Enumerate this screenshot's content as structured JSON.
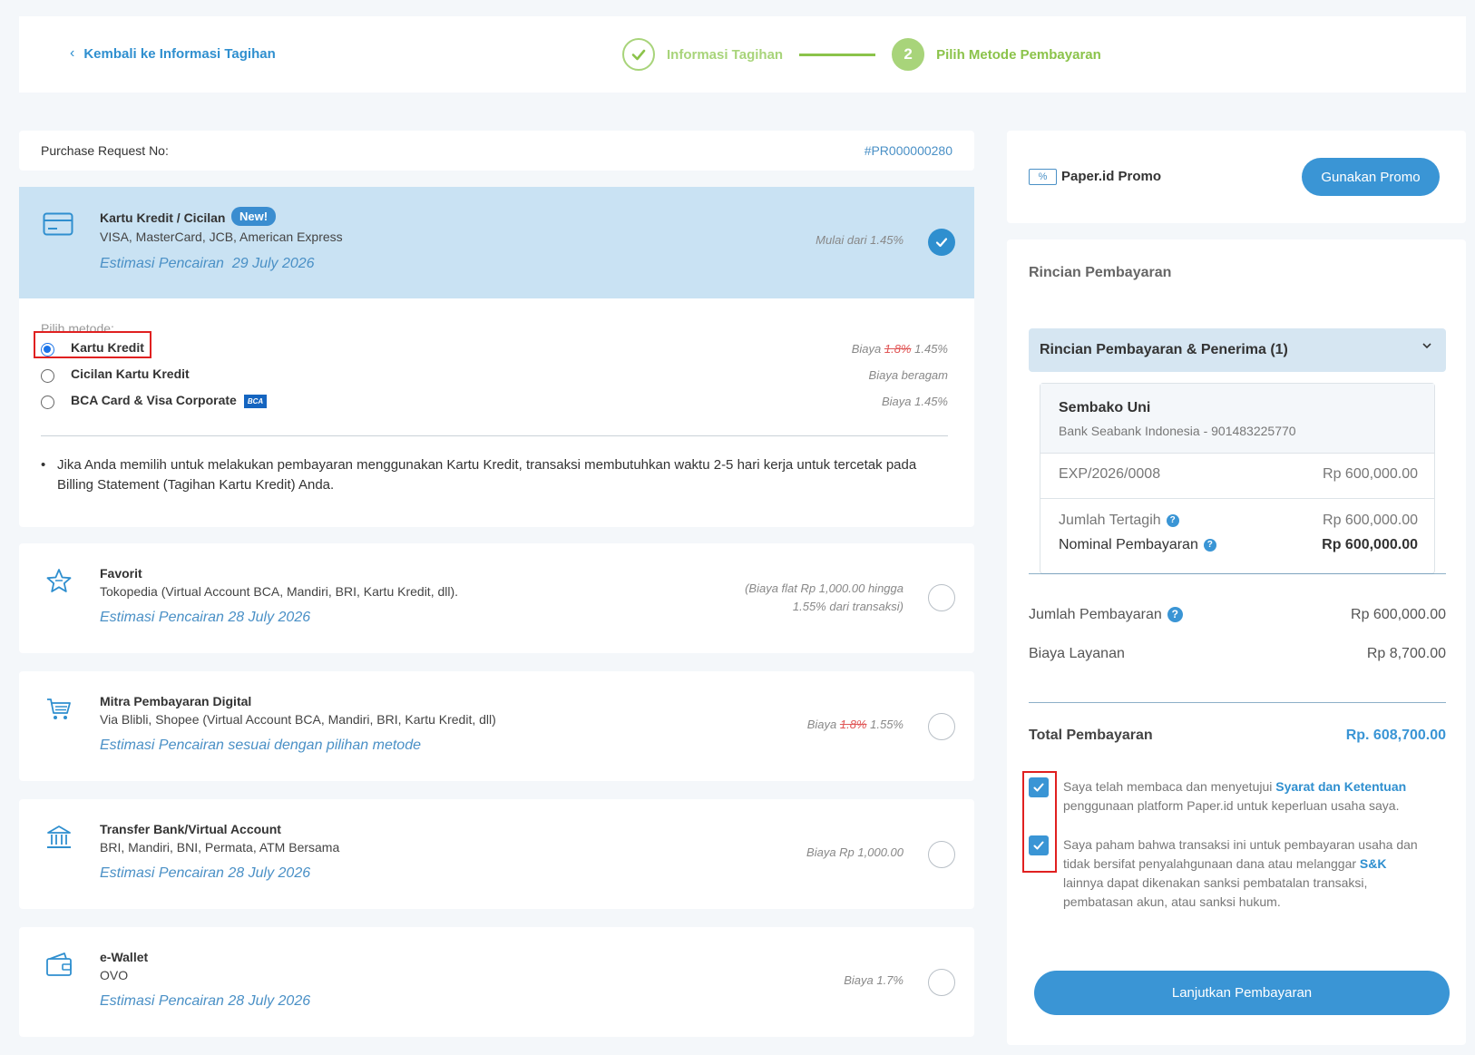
{
  "header": {
    "back_label": "Kembali ke Informasi Tagihan",
    "steps": [
      {
        "number": "✓",
        "label": "Informasi Tagihan"
      },
      {
        "number": "2",
        "label": "Pilih Metode Pembayaran"
      }
    ]
  },
  "purchase_request": {
    "label": "Purchase Request No:",
    "number": "#PR000000280"
  },
  "credit_card": {
    "title": "Kartu Kredit / Cicilan",
    "badge": "New!",
    "subtitle": "VISA, MasterCard, JCB, American Express",
    "estimate_label": "Estimasi Pencairan",
    "estimate_date": "29 July 2026",
    "fee": "Mulai dari 1.45%",
    "choose_label": "Pilih metode:",
    "options": [
      {
        "label": "Kartu Kredit",
        "fee_prefix": "Biaya",
        "fee_old": "1.8%",
        "fee": "1.45%",
        "selected": true
      },
      {
        "label": "Cicilan Kartu Kredit",
        "fee": "Biaya beragam",
        "selected": false
      },
      {
        "label": "BCA Card & Visa Corporate",
        "logo": "BCA",
        "fee": "Biaya 1.45%",
        "selected": false
      }
    ],
    "note": "Jika Anda memilih untuk melakukan pembayaran menggunakan Kartu Kredit, transaksi membutuhkan waktu 2-5 hari kerja untuk tercetak pada Billing Statement (Tagihan Kartu Kredit) Anda."
  },
  "methods": [
    {
      "icon": "star-icon",
      "title": "Favorit",
      "subtitle": "Tokopedia (Virtual Account BCA, Mandiri, BRI, Kartu Kredit, dll).",
      "estimate": "Estimasi Pencairan  28 July 2026",
      "fee_line1": "(Biaya flat Rp 1,000.00 hingga",
      "fee_line2": "1.55% dari transaksi)"
    },
    {
      "icon": "cart-icon",
      "title": "Mitra Pembayaran Digital",
      "subtitle": "Via Blibli, Shopee (Virtual Account BCA, Mandiri, BRI, Kartu Kredit, dll)",
      "estimate": "Estimasi Pencairan sesuai dengan pilihan metode",
      "fee_prefix": "Biaya",
      "fee_old": "1.8%",
      "fee": "1.55%"
    },
    {
      "icon": "bank-icon",
      "title": "Transfer Bank/Virtual Account",
      "subtitle": "BRI, Mandiri, BNI, Permata, ATM Bersama",
      "estimate": "Estimasi Pencairan  28 July 2026",
      "fee": "Biaya Rp 1,000.00"
    },
    {
      "icon": "wallet-icon",
      "title": "e-Wallet",
      "subtitle": "OVO",
      "estimate": "Estimasi Pencairan  28 July 2026",
      "fee": "Biaya 1.7%"
    }
  ],
  "promo": {
    "icon_text": "%",
    "label": "Paper.id Promo",
    "button": "Gunakan Promo"
  },
  "payment_detail": {
    "title": "Rincian Pembayaran",
    "accordion_title": "Rincian Pembayaran & Penerima (1)",
    "receiver_name": "Sembako Uni",
    "receiver_bank": "Bank Seabank Indonesia - 901483225770",
    "invoice_no": "EXP/2026/0008",
    "invoice_amount": "Rp 600,000.00",
    "billed_label": "Jumlah Tertagih",
    "billed_value": "Rp 600,000.00",
    "nominal_label": "Nominal Pembayaran",
    "nominal_value": "Rp 600,000.00",
    "amount_label": "Jumlah Pembayaran",
    "amount_value": "Rp 600,000.00",
    "service_label": "Biaya Layanan",
    "service_value": "Rp 8,700.00",
    "total_label": "Total Pembayaran",
    "total_value": "Rp. 608,700.00"
  },
  "agreements": {
    "a1_text": "Saya telah membaca dan menyetujui ",
    "a1_link": "Syarat dan Ketentuan",
    "a1_rest": " penggunaan platform Paper.id untuk keperluan usaha saya.",
    "a2_text": "Saya paham bahwa transaksi ini untuk pembayaran usaha dan tidak bersifat penyalahgunaan dana atau melanggar ",
    "a2_link": "S&K",
    "a2_rest": " lainnya dapat dikenakan sanksi pembatalan transaksi, pembatasan akun, atau sanksi hukum."
  },
  "cta": "Lanjutkan Pembayaran",
  "colors": {
    "primary": "#3a95d5",
    "step_green": "#8bc34a",
    "highlight_red": "#e02020",
    "selected_bg": "#c9e2f3"
  }
}
